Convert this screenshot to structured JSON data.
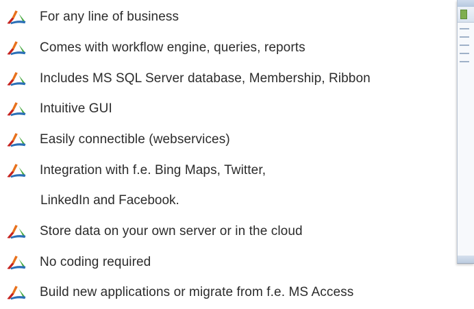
{
  "features": [
    "For any line of business",
    "Comes with workflow engine, queries, reports",
    "Includes MS SQL Server database, Membership, Ribbon",
    "Intuitive GUI",
    "Easily connectible (webservices)",
    "Integration with f.e. Bing Maps, Twitter,",
    "Store data on your own server or in the cloud",
    "No coding required",
    "Build new applications or migrate from f.e. MS Access"
  ],
  "feature_continuation": "LinkedIn and Facebook.",
  "bullet_icon": "tri-color-arrows-logo-icon",
  "colors": {
    "text": "#2b2b2b",
    "bullet_orange": "#e8711c",
    "bullet_red": "#c4221f",
    "bullet_green": "#49a942",
    "bullet_blue": "#2a6fb7"
  }
}
